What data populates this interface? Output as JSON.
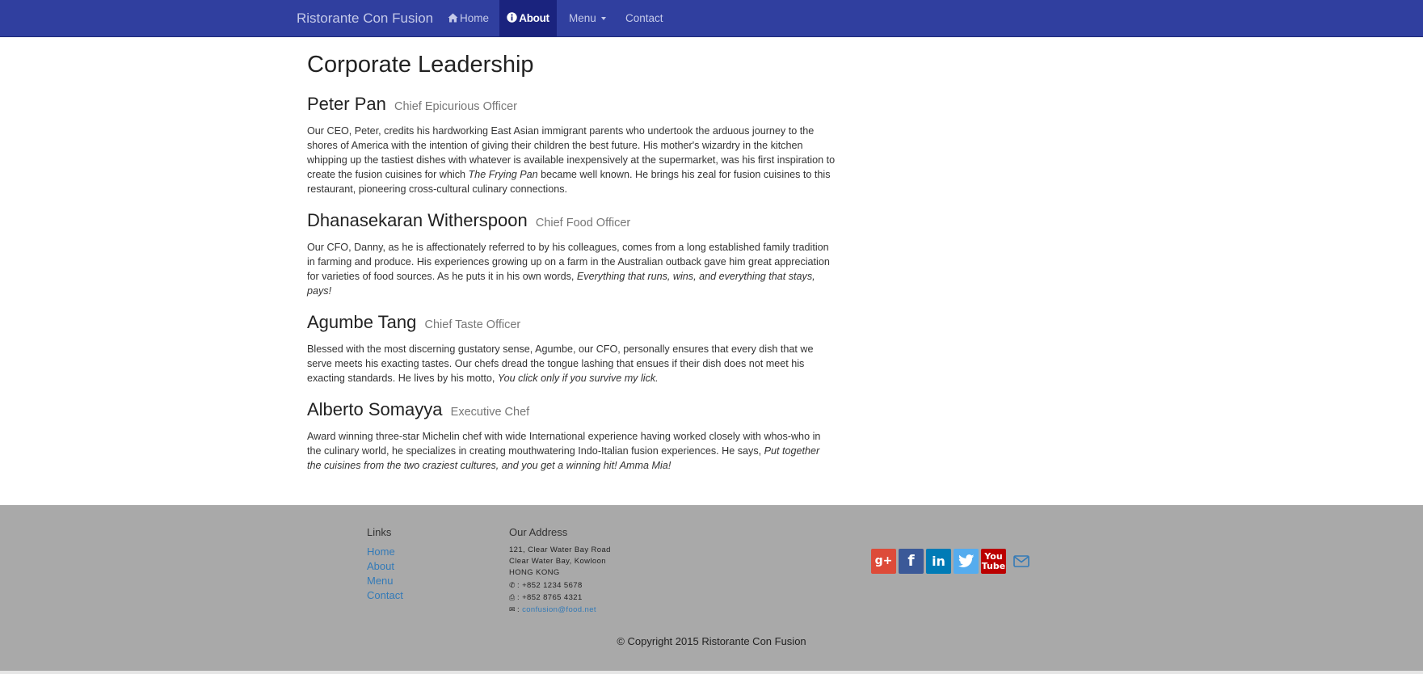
{
  "navbar": {
    "brand": "Ristorante Con Fusion",
    "items": [
      {
        "label": "Home",
        "icon": "home-icon"
      },
      {
        "label": "About",
        "icon": "info-icon",
        "active": true
      },
      {
        "label": "Menu",
        "icon": "caret-down-icon"
      },
      {
        "label": "Contact"
      }
    ]
  },
  "main": {
    "title": "Corporate Leadership",
    "leaders": [
      {
        "name": "Peter Pan",
        "role": "Chief Epicurious Officer",
        "bio_before": "Our CEO, Peter, credits his hardworking East Asian immigrant parents who undertook the arduous journey to the shores of America with the intention of giving their children the best future. His mother's wizardry in the kitchen whipping up the tastiest dishes with whatever is available inexpensively at the supermarket, was his first inspiration to create the fusion cuisines for which ",
        "bio_em": "The Frying Pan",
        "bio_after": " became well known. He brings his zeal for fusion cuisines to this restaurant, pioneering cross-cultural culinary connections."
      },
      {
        "name": "Dhanasekaran Witherspoon",
        "role": "Chief Food Officer",
        "bio_before": "Our CFO, Danny, as he is affectionately referred to by his colleagues, comes from a long established family tradition in farming and produce. His experiences growing up on a farm in the Australian outback gave him great appreciation for varieties of food sources. As he puts it in his own words, ",
        "bio_em": "Everything that runs, wins, and everything that stays, pays!",
        "bio_after": ""
      },
      {
        "name": "Agumbe Tang",
        "role": "Chief Taste Officer",
        "bio_before": "Blessed with the most discerning gustatory sense, Agumbe, our CFO, personally ensures that every dish that we serve meets his exacting tastes. Our chefs dread the tongue lashing that ensues if their dish does not meet his exacting standards. He lives by his motto, ",
        "bio_em": "You click only if you survive my lick.",
        "bio_after": ""
      },
      {
        "name": "Alberto Somayya",
        "role": "Executive Chef",
        "bio_before": "Award winning three-star Michelin chef with wide International experience having worked closely with whos-who in the culinary world, he specializes in creating mouthwatering Indo-Italian fusion experiences. He says, ",
        "bio_em": "Put together the cuisines from the two craziest cultures, and you get a winning hit! Amma Mia!",
        "bio_after": ""
      }
    ]
  },
  "footer": {
    "links_heading": "Links",
    "links": [
      "Home",
      "About",
      "Menu",
      "Contact"
    ],
    "address_heading": "Our Address",
    "address_lines": [
      "121, Clear Water Bay Road",
      "Clear Water Bay, Kowloon",
      "HONG KONG"
    ],
    "phone": ": +852 1234 5678",
    "fax": ": +852 8765 4321",
    "email": "confusion@food.net",
    "social": [
      "google-plus-icon",
      "facebook-icon",
      "linkedin-icon",
      "twitter-icon",
      "youtube-icon",
      "envelope-icon"
    ],
    "copyright": "© Copyright 2015 Ristorante Con Fusion"
  },
  "colors": {
    "navbar": "#303f9f",
    "navbar_active": "#1a237e",
    "footer": "#a9a9a9",
    "link": "#337ab7"
  }
}
